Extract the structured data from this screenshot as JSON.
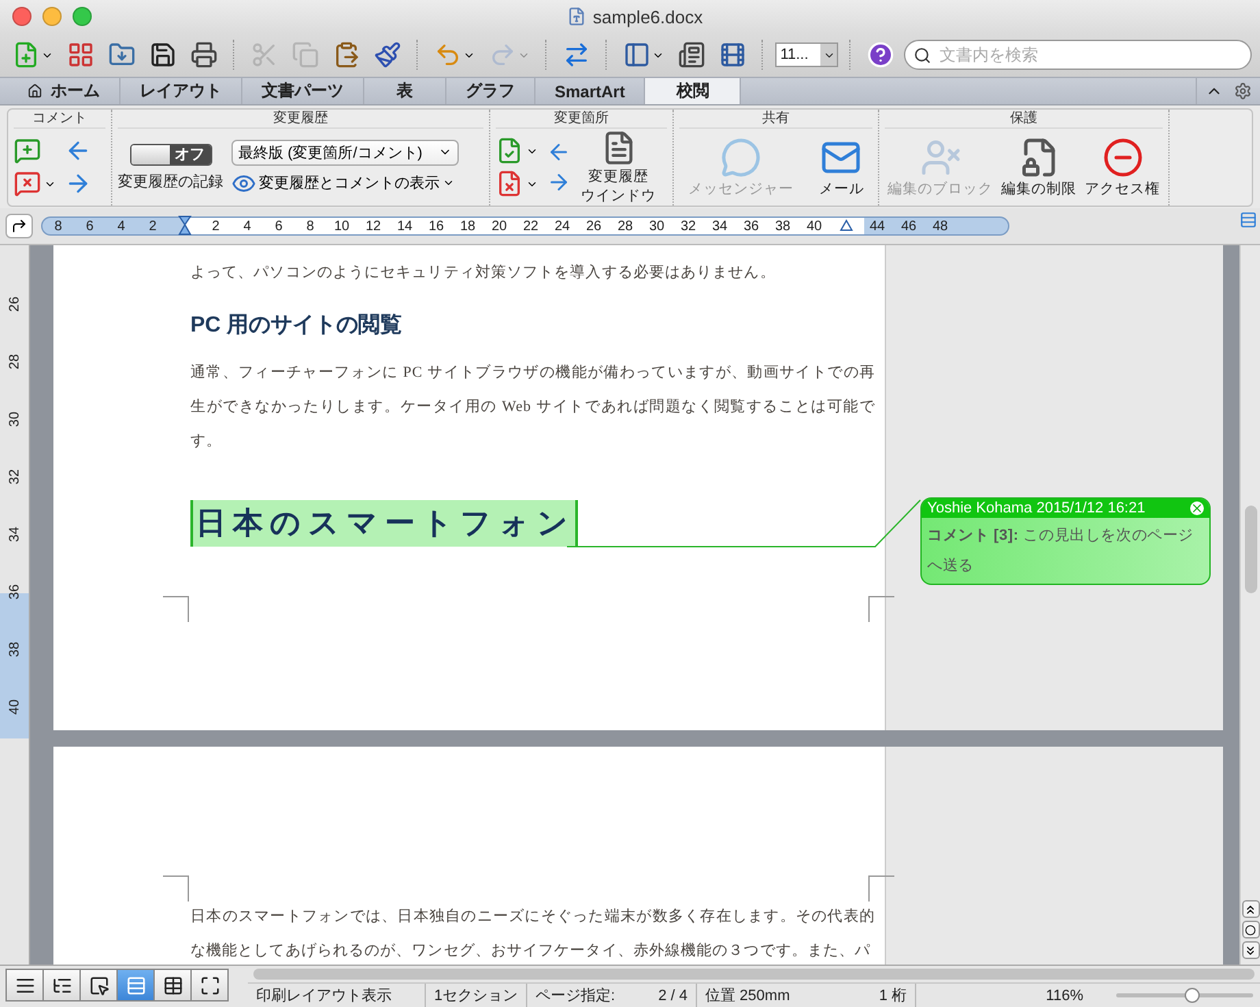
{
  "window": {
    "title": "sample6.docx"
  },
  "toolbar": {
    "buttons": [
      {
        "disabled": false
      },
      {
        "disabled": false
      },
      {
        "disabled": false
      },
      {
        "disabled": false
      },
      {
        "disabled": false
      },
      {
        "disabled": true
      },
      {
        "disabled": true
      },
      {
        "disabled": false
      },
      {
        "disabled": false
      },
      {
        "disabled": false
      },
      {
        "disabled": true
      },
      {
        "disabled": false
      },
      {
        "disabled": false
      },
      {
        "disabled": false
      },
      {
        "disabled": false
      }
    ],
    "font_size": "11...",
    "search": {
      "placeholder": "文書内を検索"
    }
  },
  "tabs": [
    {
      "label": "ホーム",
      "selected": false
    },
    {
      "label": "レイアウト",
      "selected": false
    },
    {
      "label": "文書パーツ",
      "selected": false
    },
    {
      "label": "表",
      "selected": false
    },
    {
      "label": "グラフ",
      "selected": false
    },
    {
      "label": "SmartArt",
      "selected": false
    },
    {
      "label": "校閲",
      "selected": true
    }
  ],
  "ribbon": {
    "comments": {
      "title": "コメント"
    },
    "tracking": {
      "title": "変更履歴",
      "toggle": {
        "label": "オフ",
        "on": false
      },
      "record_label": "変更履歴の記録",
      "display_select": "最終版 (変更箇所/コメント)",
      "show_button": "変更履歴とコメントの表示"
    },
    "changes": {
      "title": "変更箇所",
      "window_button": [
        "変更履歴",
        "ウインドウ"
      ]
    },
    "share": {
      "title": "共有",
      "buttons": [
        {
          "label": "メッセンジャー",
          "disabled": true
        },
        {
          "label": "メール",
          "disabled": false
        }
      ]
    },
    "protect": {
      "title": "保護",
      "buttons": [
        {
          "label": "編集のブロック",
          "disabled": true
        },
        {
          "label": "編集の制限",
          "disabled": false
        },
        {
          "label": "アクセス権",
          "disabled": false
        }
      ]
    }
  },
  "ruler": {
    "labels": [
      "8",
      "6",
      "4",
      "2",
      "2",
      "4",
      "6",
      "8",
      "10",
      "12",
      "14",
      "16",
      "18",
      "20",
      "22",
      "24",
      "26",
      "28",
      "30",
      "32",
      "34",
      "36",
      "38",
      "40",
      "44",
      "46",
      "48"
    ]
  },
  "vertical_ruler": {
    "labels": [
      "26",
      "28",
      "30",
      "32",
      "34",
      "36",
      "38",
      "40"
    ]
  },
  "page1": {
    "paragraphs": [
      {
        "kind": "body",
        "text": "よって、パソコンのようにセキュリティ対策ソフトを導入する必要はありません。"
      },
      {
        "kind": "heading",
        "text": "PC 用のサイトの閲覧"
      },
      {
        "kind": "body",
        "text": "通常、フィーチャーフォンに PC サイトブラウザの機能が備わっていますが、動画サイトでの再生ができなかったりします。ケータイ用の Web サイトであれば問題なく閲覧することは可能です。"
      },
      {
        "kind": "title",
        "text": "日本のスマートフォン",
        "commented": true
      }
    ]
  },
  "comment": {
    "header": "Yoshie Kohama 2015/1/12 16:21",
    "text": "**コメント [3]:** この見出しを次のページへ送る"
  },
  "page2": {
    "paragraphs": [
      {
        "kind": "body",
        "text": "日本のスマートフォンでは、日本独自のニーズにそぐった端末が数多く存在します。その代表的な機能としてあげられるのが、ワンセグ、おサイフケータイ、赤外線機能の３つです。また、パ"
      }
    ]
  },
  "view_buttons": [
    {
      "selected": false
    },
    {
      "selected": false
    },
    {
      "selected": false
    },
    {
      "selected": true
    },
    {
      "selected": false
    },
    {
      "selected": false
    }
  ],
  "status": {
    "view": "印刷レイアウト表示",
    "section": "1セクション",
    "page_label": "ページ指定:",
    "page": "2 / 4",
    "position": "位置 250mm",
    "column": "1 桁",
    "zoom": "116%"
  },
  "zoom_slider": {
    "level": 0.55
  }
}
